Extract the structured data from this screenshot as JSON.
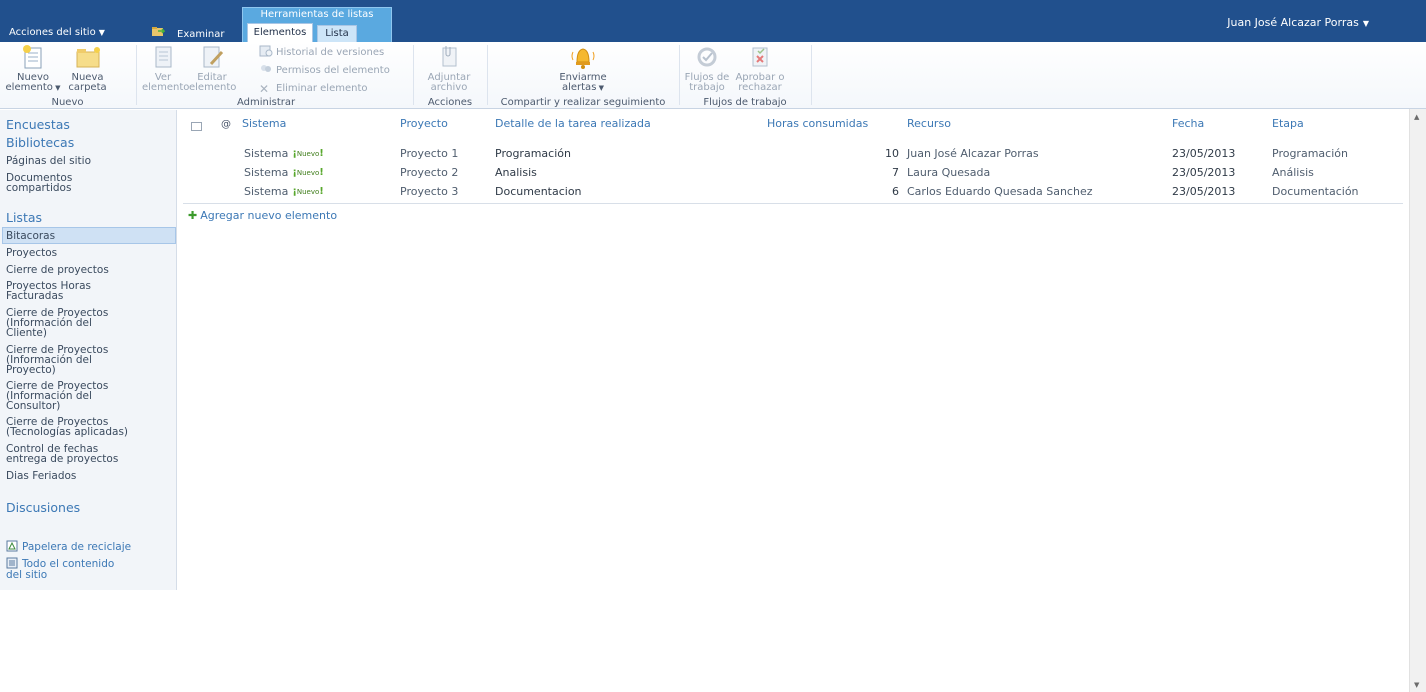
{
  "topbar": {
    "site_actions": "Acciones del sitio",
    "browse_tab": "Examinar",
    "tools_group": "Herramientas de listas",
    "tabs": [
      {
        "label": "Elementos"
      },
      {
        "label": "Lista"
      }
    ],
    "user": "Juan José Alcazar Porras"
  },
  "ribbon": {
    "groups": {
      "nuevo": "Nuevo",
      "administrar": "Administrar",
      "acciones": "Acciones",
      "compartir": "Compartir y realizar seguimiento",
      "flujos": "Flujos de trabajo"
    },
    "buttons": {
      "nuevo_elemento_1": "Nuevo",
      "nuevo_elemento_2": "elemento",
      "nueva_carpeta_1": "Nueva",
      "nueva_carpeta_2": "carpeta",
      "ver_1": "Ver",
      "ver_2": "elemento",
      "editar_1": "Editar",
      "editar_2": "elemento",
      "historial": "Historial de versiones",
      "permisos": "Permisos del elemento",
      "eliminar": "Eliminar elemento",
      "adjuntar_1": "Adjuntar",
      "adjuntar_2": "archivo",
      "alertas_1": "Enviarme",
      "alertas_2": "alertas",
      "flujos_1": "Flujos de",
      "flujos_2": "trabajo",
      "aprobar_1": "Aprobar o",
      "aprobar_2": "rechazar"
    }
  },
  "leftnav": {
    "encuestas": "Encuestas",
    "bibliotecas": "Bibliotecas",
    "paginas": "Páginas del sitio",
    "documentos_1": "Documentos",
    "documentos_2": "compartidos",
    "listas": "Listas",
    "items": [
      {
        "l1": "Bitacoras"
      },
      {
        "l1": "Proyectos"
      },
      {
        "l1": "Cierre de proyectos"
      },
      {
        "l1": "Proyectos Horas",
        "l2": "Facturadas"
      },
      {
        "l1": "Cierre de Proyectos",
        "l2": "(Información del",
        "l3": "Cliente)"
      },
      {
        "l1": "Cierre de Proyectos",
        "l2": "(Información del",
        "l3": "Proyecto)"
      },
      {
        "l1": "Cierre de Proyectos",
        "l2": "(Información del",
        "l3": "Consultor)"
      },
      {
        "l1": "Cierre de Proyectos",
        "l2": "(Tecnologías aplicadas)"
      },
      {
        "l1": "Control de fechas",
        "l2": "entrega de proyectos"
      },
      {
        "l1": "Dias Feriados"
      }
    ],
    "discusiones": "Discusiones",
    "papelera": "Papelera de reciclaje",
    "todo_1": "Todo el contenido",
    "todo_2": "del sitio"
  },
  "list": {
    "columns": [
      "Sistema",
      "Proyecto",
      "Detalle de la tarea realizada",
      "Horas consumidas",
      "Recurso",
      "Fecha",
      "Etapa"
    ],
    "new_badge": "Nuevo",
    "rows": [
      {
        "sistema": "Sistema",
        "proyecto": "Proyecto 1",
        "detalle": "Programación",
        "horas": "10",
        "recurso": "Juan José Alcazar Porras",
        "fecha": "23/05/2013",
        "etapa": "Programación"
      },
      {
        "sistema": "Sistema",
        "proyecto": "Proyecto 2",
        "detalle": "Analisis",
        "horas": "7",
        "recurso": "Laura Quesada",
        "fecha": "23/05/2013",
        "etapa": "Análisis"
      },
      {
        "sistema": "Sistema",
        "proyecto": "Proyecto 3",
        "detalle": "Documentacion",
        "horas": "6",
        "recurso": "Carlos Eduardo Quesada Sanchez",
        "fecha": "23/05/2013",
        "etapa": "Documentación"
      }
    ],
    "add_new": "Agregar nuevo elemento"
  },
  "colors": {
    "topbar": "#21508d",
    "tools_group": "#5aa9e0",
    "link": "#3c78b5",
    "new_badge": "#3f7d1a"
  }
}
